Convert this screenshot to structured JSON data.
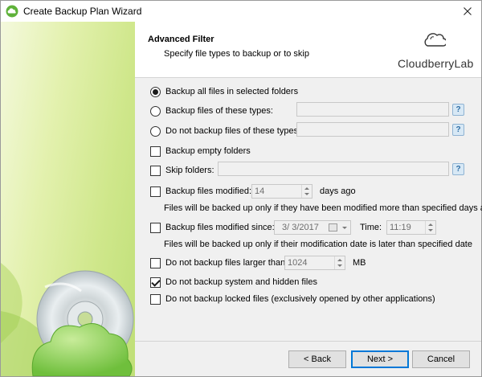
{
  "window": {
    "title": "Create Backup Plan Wizard"
  },
  "header": {
    "title": "Advanced Filter",
    "subtitle": "Specify file types to backup or to skip",
    "logo_text": "CloudberryLab"
  },
  "options": {
    "backup_all": {
      "label": "Backup all files in selected folders",
      "selected": true
    },
    "backup_types": {
      "label": "Backup files of these types:",
      "selected": false,
      "value": ""
    },
    "skip_types": {
      "label": "Do not backup files of these types:",
      "selected": false,
      "value": ""
    },
    "backup_empty": {
      "label": "Backup empty folders",
      "checked": false
    },
    "skip_folders": {
      "label": "Skip folders:",
      "checked": false,
      "value": ""
    },
    "modified_days": {
      "label": "Backup files modified:",
      "checked": false,
      "value": "14",
      "unit": "days ago",
      "note": "Files will be backed up only if they have been modified more than specified days ago"
    },
    "modified_since": {
      "label": "Backup files modified since:",
      "checked": false,
      "date": "3/  3/2017",
      "time_label": "Time:",
      "time": "11:19",
      "note": "Files will be backed up only if their modification date is later than specified date"
    },
    "larger_than": {
      "label": "Do not backup files larger than:",
      "checked": false,
      "value": "1024",
      "unit": "MB"
    },
    "system_hidden": {
      "label": "Do not backup system and hidden files",
      "checked": true
    },
    "locked": {
      "label": "Do not backup locked files (exclusively opened by other applications)",
      "checked": false
    }
  },
  "buttons": {
    "back": "< Back",
    "next": "Next >",
    "cancel": "Cancel"
  },
  "icons": {
    "app": "cloud-app-icon",
    "close": "close-icon",
    "help": "help-icon",
    "calendar": "calendar-icon",
    "disc": "cd-disc-icon"
  },
  "colors": {
    "accent": "#0078d7",
    "panel_green": "#cfe78b",
    "help_blue": "#2f6ea5"
  }
}
